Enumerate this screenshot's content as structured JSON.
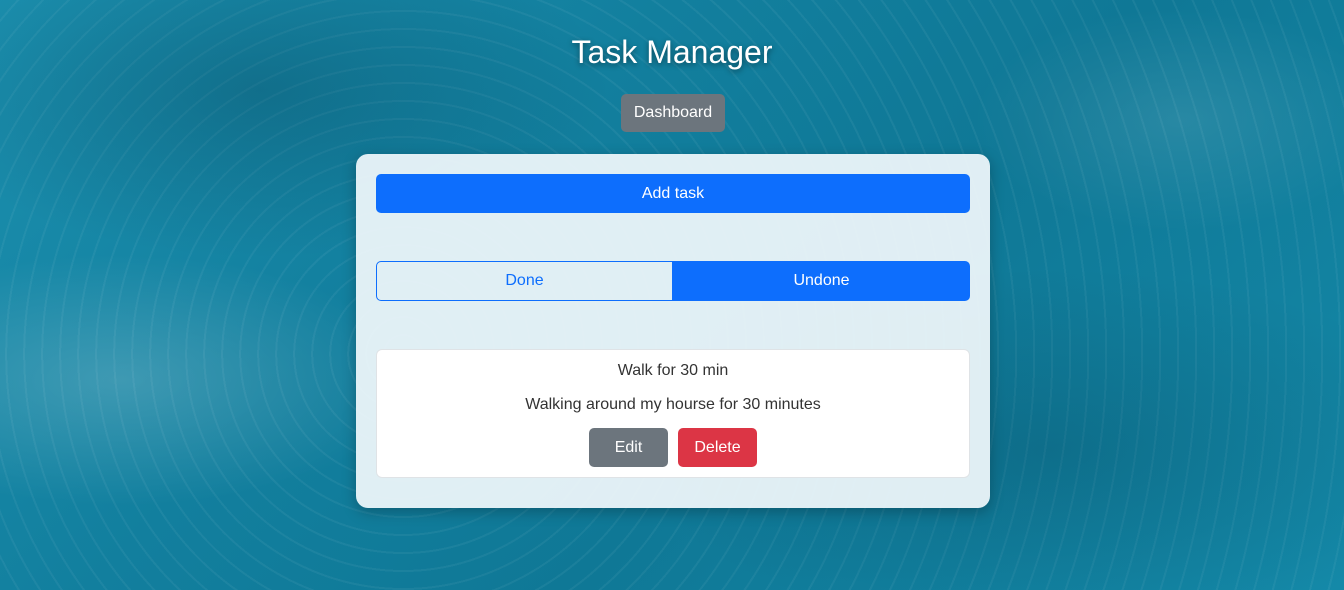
{
  "app": {
    "title": "Task Manager"
  },
  "nav": {
    "dashboard_label": "Dashboard"
  },
  "panel": {
    "add_task_label": "Add task",
    "filter": {
      "done_label": "Done",
      "undone_label": "Undone",
      "selected": "Undone"
    }
  },
  "tasks": [
    {
      "title": "Walk for 30 min",
      "description": "Walking around my hourse for 30 minutes",
      "edit_label": "Edit",
      "delete_label": "Delete"
    }
  ],
  "colors": {
    "primary": "#0d6efd",
    "secondary": "#6c757d",
    "danger": "#dc3545"
  }
}
